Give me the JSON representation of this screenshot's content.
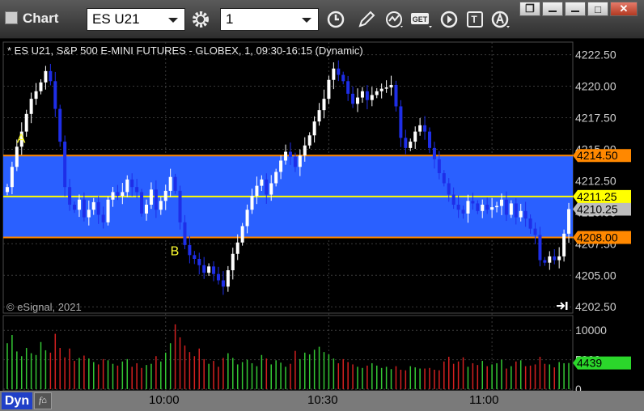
{
  "app": {
    "title": "Chart"
  },
  "toolbar": {
    "symbol": "ES U21",
    "interval": "1",
    "icons": [
      "gear-icon",
      "clock-icon",
      "pencil-icon",
      "line-study-icon",
      "get-icon",
      "play-icon",
      "text-tool-icon",
      "alert-icon"
    ],
    "get_label": "GET",
    "text_label": "T"
  },
  "window_buttons": {
    "restore": "❐",
    "maximize": "□",
    "close": "✕"
  },
  "chart_header": "* ES U21, S&P 500 E-MINI FUTURES - GLOBEX, 1, 09:30-16:15 (Dynamic)",
  "watermark": "© eSignal, 2021",
  "statusbar": {
    "dyn": "Dyn",
    "times": [
      "10:00",
      "10:30",
      "11:00"
    ]
  },
  "chart_data": [
    {
      "type": "candlestick",
      "y_ticks": [
        4222.5,
        4220.0,
        4217.5,
        4215.0,
        4212.5,
        4210.0,
        4207.5,
        4205.0,
        4202.5
      ],
      "y_tick_labels": [
        "4222.50",
        "4220.00",
        "4217.50",
        "4215.00",
        "4212.50",
        "4210.00",
        "4207.50",
        "4205.00",
        "4202.50"
      ],
      "ylim": [
        4202.0,
        4223.5
      ],
      "x_ticks": [
        "10:00",
        "10:30",
        "11:00"
      ],
      "grid": true,
      "zone": {
        "top": 4214.5,
        "bottom": 4208.0,
        "color": "#2a60ff"
      },
      "lines": [
        {
          "value": 4214.5,
          "label": "4214.50",
          "color": "#ff8800"
        },
        {
          "value": 4211.25,
          "label": "4211.25",
          "color": "#ffff00"
        },
        {
          "value": 4208.0,
          "label": "4208.00",
          "color": "#ff8800"
        }
      ],
      "last_price": {
        "value": 4210.25,
        "label": "4210.25"
      },
      "annotations": [
        {
          "text": "A",
          "price": 4215.5,
          "bar_index": 3
        },
        {
          "text": "B",
          "price": 4206.6,
          "bar_index": 35
        }
      ],
      "closes": [
        4212.0,
        4213.6,
        4215.2,
        4216.4,
        4217.8,
        4219.0,
        4219.6,
        4220.3,
        4221.2,
        4220.4,
        4218.2,
        4215.6,
        4212.0,
        4210.6,
        4210.2,
        4211.0,
        4209.6,
        4210.2,
        4210.8,
        4209.8,
        4209.2,
        4211.0,
        4211.6,
        4211.3,
        4211.6,
        4212.6,
        4212.0,
        4211.6,
        4209.9,
        4210.6,
        4211.8,
        4210.2,
        4210.9,
        4211.7,
        4212.8,
        4211.7,
        4209.2,
        4207.4,
        4206.6,
        4206.3,
        4205.8,
        4205.2,
        4205.7,
        4205.1,
        4204.6,
        4204.1,
        4205.4,
        4206.7,
        4207.6,
        4208.9,
        4210.2,
        4211.3,
        4212.1,
        4212.6,
        4211.4,
        4212.3,
        4213.2,
        4214.1,
        4214.8,
        4214.4,
        4213.6,
        4214.5,
        4215.3,
        4216.1,
        4217.2,
        4218.1,
        4219.0,
        4220.5,
        4221.4,
        4220.9,
        4220.4,
        4219.4,
        4218.6,
        4219.1,
        4219.6,
        4218.9,
        4219.3,
        4219.6,
        4219.8,
        4219.9,
        4220.1,
        4218.4,
        4215.9,
        4215.1,
        4215.6,
        4216.4,
        4216.9,
        4216.4,
        4215.1,
        4214.2,
        4213.1,
        4212.3,
        4211.4,
        4210.6,
        4210.2,
        4209.9,
        4210.9,
        4210.7,
        4210.1,
        4210.6,
        4210.2,
        4210.4,
        4210.5,
        4211.0,
        4209.8,
        4210.7,
        4209.6,
        4210.1,
        4209.5,
        4208.7,
        4208.2,
        4206.2,
        4206.0,
        4206.5,
        4206.2,
        4206.5,
        4208.3,
        4210.25
      ],
      "volume": {
        "y_ticks": [
          10000,
          5000,
          0
        ],
        "y_tick_labels": [
          "10000",
          "5000",
          "0"
        ],
        "ylim": [
          0,
          12500
        ],
        "last": {
          "value": 4439,
          "label": "4439"
        },
        "values": [
          7800,
          9200,
          6400,
          5600,
          7000,
          6100,
          5800,
          8000,
          6600,
          6200,
          9400,
          7000,
          5400,
          6900,
          4800,
          5300,
          5700,
          5200,
          4600,
          4200,
          5100,
          4900,
          4300,
          4000,
          4700,
          5100,
          3800,
          4400,
          3600,
          4100,
          4300,
          5600,
          4700,
          6200,
          7800,
          11000,
          8800,
          7400,
          6300,
          5600,
          6900,
          5100,
          4300,
          4800,
          3800,
          5300,
          6100,
          5300,
          4200,
          4600,
          5000,
          4400,
          3900,
          5800,
          5200,
          4200,
          4900,
          4500,
          3800,
          4300,
          6500,
          5100,
          6200,
          5900,
          6700,
          7200,
          6300,
          5900,
          5200,
          4400,
          5100,
          4600,
          4200,
          3800,
          3600,
          4000,
          4400,
          4000,
          3600,
          3800,
          3400,
          3900,
          3300,
          3200,
          3900,
          3700,
          3500,
          3500,
          3600,
          3300,
          3200,
          4700,
          5500,
          4300,
          4700,
          5400,
          3800,
          4400,
          4100,
          4800,
          3900,
          4200,
          4400,
          5000,
          3500,
          3900,
          4700,
          4900,
          3900,
          4000,
          4200,
          5500,
          4300,
          4200,
          3700,
          4600,
          4400,
          4439
        ]
      }
    }
  ]
}
